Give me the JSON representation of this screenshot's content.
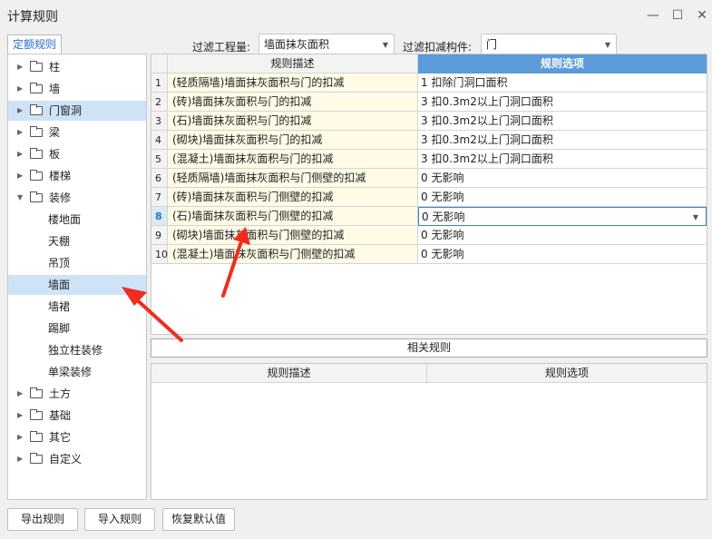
{
  "window": {
    "title": "计算规则",
    "min_icon": "minimize-icon",
    "max_icon": "maximize-icon",
    "close_icon": "close-icon"
  },
  "tab": {
    "label": "定额规则"
  },
  "filters": {
    "project_label": "过滤工程量:",
    "project_value": "墙面抹灰面积",
    "component_label": "过滤扣减构件:",
    "component_value": "门"
  },
  "tree": [
    {
      "label": "柱",
      "type": "folder"
    },
    {
      "label": "墙",
      "type": "folder"
    },
    {
      "label": "门窗洞",
      "type": "folder"
    },
    {
      "label": "梁",
      "type": "folder"
    },
    {
      "label": "板",
      "type": "folder"
    },
    {
      "label": "楼梯",
      "type": "folder"
    },
    {
      "label": "装修",
      "type": "folder-open"
    },
    {
      "label": "楼地面",
      "type": "leaf"
    },
    {
      "label": "天棚",
      "type": "leaf"
    },
    {
      "label": "吊顶",
      "type": "leaf"
    },
    {
      "label": "墙面",
      "type": "leaf"
    },
    {
      "label": "墙裙",
      "type": "leaf"
    },
    {
      "label": "踢脚",
      "type": "leaf"
    },
    {
      "label": "独立柱装修",
      "type": "leaf"
    },
    {
      "label": "单梁装修",
      "type": "leaf"
    },
    {
      "label": "土方",
      "type": "folder"
    },
    {
      "label": "基础",
      "type": "folder"
    },
    {
      "label": "其它",
      "type": "folder"
    },
    {
      "label": "自定义",
      "type": "folder"
    }
  ],
  "grid": {
    "col_desc": "规则描述",
    "col_opt": "规则选项",
    "rows": [
      {
        "num": "1",
        "desc": "(轻质隔墙)墙面抹灰面积与门的扣减",
        "opt": "1 扣除门洞口面积"
      },
      {
        "num": "2",
        "desc": "(砖)墙面抹灰面积与门的扣减",
        "opt": "3 扣0.3m2以上门洞口面积"
      },
      {
        "num": "3",
        "desc": "(石)墙面抹灰面积与门的扣减",
        "opt": "3 扣0.3m2以上门洞口面积"
      },
      {
        "num": "4",
        "desc": "(砌块)墙面抹灰面积与门的扣减",
        "opt": "3 扣0.3m2以上门洞口面积"
      },
      {
        "num": "5",
        "desc": "(混凝土)墙面抹灰面积与门的扣减",
        "opt": "3 扣0.3m2以上门洞口面积"
      },
      {
        "num": "6",
        "desc": "(轻质隔墙)墙面抹灰面积与门侧壁的扣减",
        "opt": "0  无影响"
      },
      {
        "num": "7",
        "desc": "(砖)墙面抹灰面积与门侧壁的扣减",
        "opt": "0  无影响"
      },
      {
        "num": "8",
        "desc": "(石)墙面抹灰面积与门侧壁的扣减",
        "opt": "0  无影响"
      },
      {
        "num": "9",
        "desc": "(砌块)墙面抹灰面积与门侧壁的扣减",
        "opt": "0  无影响"
      },
      {
        "num": "10",
        "desc": "(混凝土)墙面抹灰面积与门侧壁的扣减",
        "opt": "0  无影响"
      }
    ]
  },
  "related": {
    "title": "相关规则",
    "col_desc": "规则描述",
    "col_opt": "规则选项"
  },
  "buttons": {
    "export": "导出规则",
    "import": "导入规则",
    "restore": "恢复默认值"
  },
  "colors": {
    "accent": "#5b9bd9",
    "selection": "#cfe3f7",
    "desc_cell": "#fffbe6",
    "annotation": "#f02d1d"
  }
}
